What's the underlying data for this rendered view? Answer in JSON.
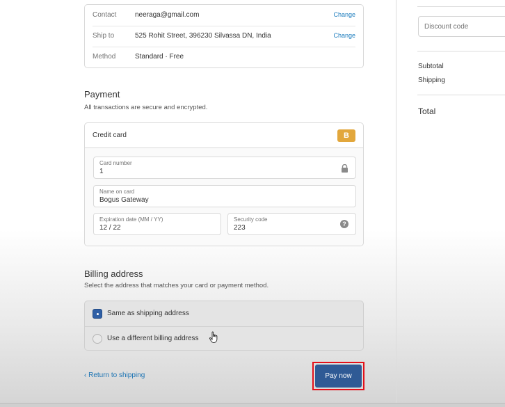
{
  "review": {
    "contact_label": "Contact",
    "contact_value": "neeraga@gmail.com",
    "contact_change": "Change",
    "shipto_label": "Ship to",
    "shipto_value": "525 Rohit Street, 396230 Silvassa DN, India",
    "shipto_change": "Change",
    "method_label": "Method",
    "method_value": "Standard · Free"
  },
  "payment": {
    "title": "Payment",
    "subtitle": "All transactions are secure and encrypted.",
    "method_label": "Credit card",
    "badge": "B",
    "card_number_label": "Card number",
    "card_number_value": "1",
    "name_label": "Name on card",
    "name_value": "Bogus Gateway",
    "expiry_label": "Expiration date (MM / YY)",
    "expiry_value": "12 / 22",
    "cvv_label": "Security code",
    "cvv_value": "223",
    "help_glyph": "?"
  },
  "billing": {
    "title": "Billing address",
    "subtitle": "Select the address that matches your card or payment method.",
    "options": [
      {
        "label": "Same as shipping address",
        "selected": true
      },
      {
        "label": "Use a different billing address",
        "selected": false
      }
    ]
  },
  "footer": {
    "return_label": "‹ Return to shipping",
    "pay_label": "Pay now"
  },
  "sidebar": {
    "discount_placeholder": "Discount code",
    "subtotal_label": "Subtotal",
    "shipping_label": "Shipping",
    "total_label": "Total"
  },
  "colors": {
    "accent": "#2f5a95",
    "link": "#197bbd",
    "highlight": "#e3101a",
    "badge": "#e2a73c"
  }
}
